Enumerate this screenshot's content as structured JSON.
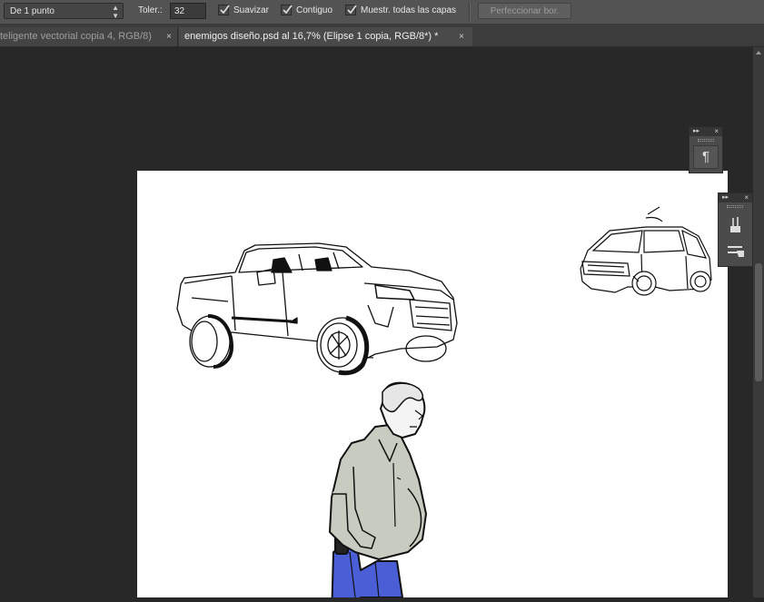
{
  "options_bar": {
    "sample_size": "De 1 punto",
    "tolerance_label": "Toler.:",
    "tolerance_value": "32",
    "antialias_label": "Suavizar",
    "contiguous_label": "Contiguo",
    "sample_all_layers_label": "Muestr. todas las capas",
    "refine_edge_label": "Perfeccionar bor."
  },
  "tabs": [
    {
      "title": "teligente vectorial copia 4, RGB/8)",
      "active": false,
      "close": "×"
    },
    {
      "title": "enemigos diseño.psd al 16,7% (Elipse 1 copia, RGB/8*) *",
      "active": true,
      "close": "×"
    }
  ],
  "panels": {
    "paragraph": {
      "collapse": "▸▸",
      "close": "×",
      "icon": "¶"
    },
    "tools": {
      "collapse": "▸▸",
      "close": "×",
      "icons": [
        "brush-presets-icon",
        "tool-presets-icon"
      ]
    }
  },
  "colors": {
    "shirt": "#c8ccc0",
    "jeans": "#4a5fd6",
    "ui_dark": "#282828",
    "ui_bar": "#535353"
  }
}
